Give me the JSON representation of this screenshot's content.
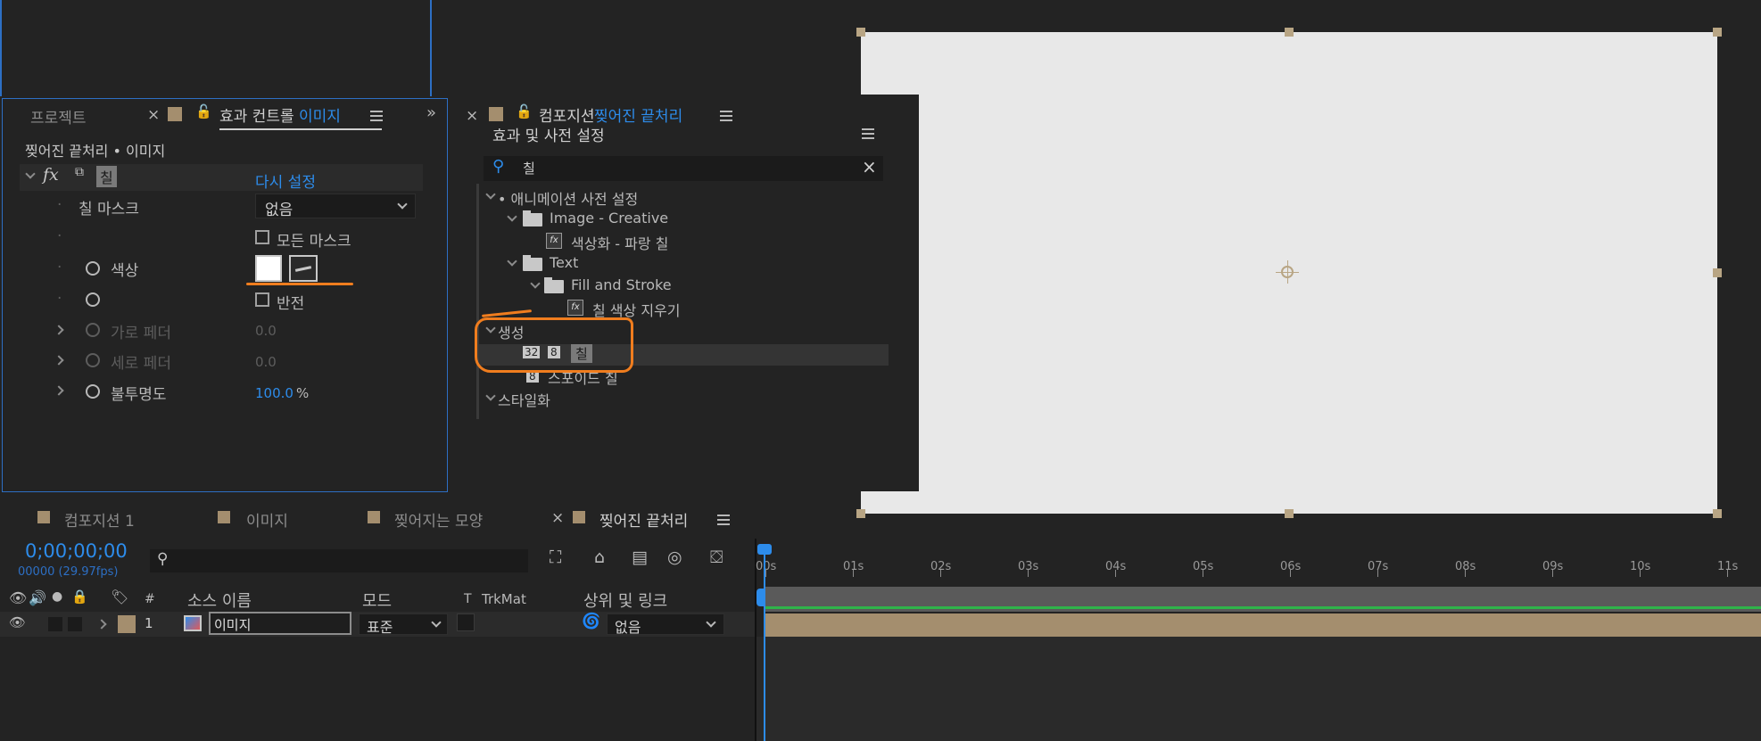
{
  "project_panel": {
    "tab_project": "프로젝트",
    "tab_effect_controls": "효과 컨트롤",
    "tab_effect_controls_target": "이미지",
    "breadcrumb": "찢어진 끝처리 • 이미지"
  },
  "effect": {
    "name": "칠",
    "fx": "fx",
    "reset": "다시 설정",
    "fill_mask_label": "칠 마스크",
    "fill_mask_value": "없음",
    "all_masks_label": "모든 마스크",
    "color_label": "색상",
    "color_value": "#ffffff",
    "invert_label": "반전",
    "h_feather_label": "가로 페더",
    "h_feather_value": "0.0",
    "v_feather_label": "세로 페더",
    "v_feather_value": "0.0",
    "opacity_label": "불투명도",
    "opacity_value": "100.0",
    "opacity_unit": "%"
  },
  "comp_panel": {
    "tab_label_prefix": "컴포지션",
    "tab_label_name": "찢어진 끝처리"
  },
  "effects_presets": {
    "title": "효과 및 사전 설정",
    "search_value": "칠",
    "tree": [
      {
        "label": "• 애니메이션 사전 설정"
      },
      {
        "label": "Image - Creative"
      },
      {
        "label": "색상화 - 파랑 칠"
      },
      {
        "label": "Text"
      },
      {
        "label": "Fill and Stroke"
      },
      {
        "label": "칠 색상 지우기"
      },
      {
        "label": "생성"
      },
      {
        "label": "칠",
        "badge32": "32",
        "badge8": "8"
      },
      {
        "label": "스포이드 칠",
        "badge8": "8"
      },
      {
        "label": "스타일화"
      }
    ]
  },
  "timeline": {
    "tabs": [
      {
        "label": "컴포지션 1"
      },
      {
        "label": "이미지"
      },
      {
        "label": "찢어지는 모양"
      },
      {
        "label": "찢어진 끝처리"
      }
    ],
    "timecode": "0;00;00;00",
    "frame_info": "00000 (29.97fps)",
    "columns": {
      "hash": "#",
      "source_name": "소스 이름",
      "mode": "모드",
      "t": "T",
      "trkmat": "TrkMat",
      "parent": "상위 및 링크"
    },
    "layer": {
      "index": "1",
      "name": "이미지",
      "mode": "표준",
      "parent": "없음"
    },
    "ruler": [
      "00s",
      "01s",
      "02s",
      "03s",
      "04s",
      "05s",
      "06s",
      "07s",
      "08s",
      "09s",
      "10s",
      "11s"
    ]
  },
  "colors": {
    "accent": "#2d8ceb",
    "annotation": "#f07d1e",
    "canvas": "#e8e8e8",
    "layer_bar": "#a48e6e",
    "track_green": "#2fb34a"
  }
}
